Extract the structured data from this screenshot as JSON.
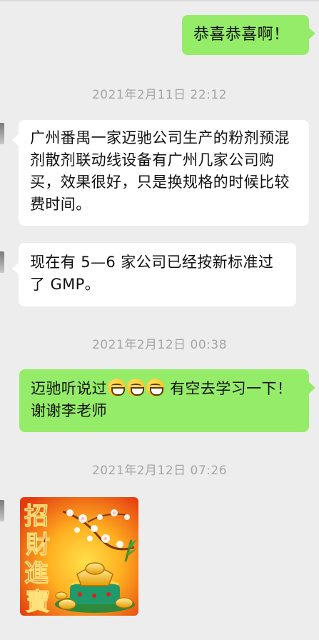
{
  "messages": [
    {
      "text": "恭喜恭喜啊！"
    },
    {
      "text": "广州番禺一家迈驰公司生产的粉剂预混剂散剂联动线设备有广州几家公司购买，效果很好，只是换规格的时候比较费时间。"
    },
    {
      "text": "现在有 5—6 家公司已经按新标准过了 GMP。"
    },
    {
      "text_before": "迈驰听说过",
      "text_after": " 有空去学习一下！谢谢李老师"
    }
  ],
  "timestamps": [
    "2021年2月11日 22:12",
    "2021年2月12日 00:38",
    "2021年2月12日 07:26"
  ],
  "sticker": {
    "chars": [
      "招",
      "財",
      "進",
      "寶"
    ]
  },
  "colors": {
    "bubble_me": "#95ec69",
    "bubble_other": "#ffffff",
    "background": "#ededed",
    "timestamp": "#a5a5a5"
  },
  "icons": [
    "grin-emoji-icon",
    "grin-emoji-icon",
    "grin-emoji-icon"
  ]
}
